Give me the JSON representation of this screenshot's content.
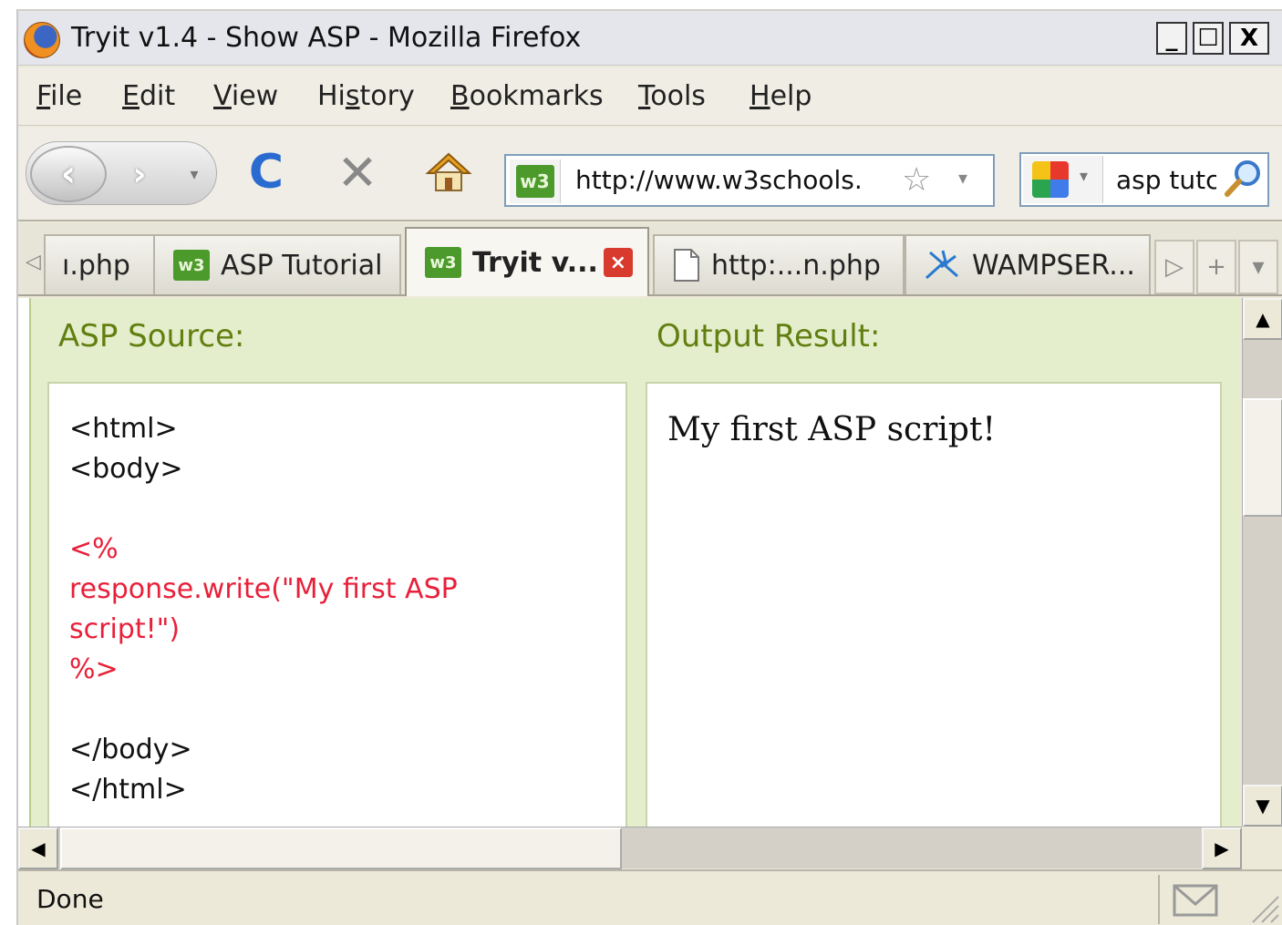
{
  "window": {
    "title": "Tryit v1.4 - Show ASP - Mozilla Firefox",
    "controls": {
      "minimize": "_",
      "maximize": "☐",
      "close": "X"
    }
  },
  "menu": [
    {
      "label": "File",
      "access": "F",
      "rest": "ile"
    },
    {
      "label": "Edit",
      "access": "E",
      "rest": "dit"
    },
    {
      "label": "View",
      "access": "V",
      "rest": "iew"
    },
    {
      "label": "History",
      "pre": "Hi",
      "access": "s",
      "rest": "tory"
    },
    {
      "label": "Bookmarks",
      "access": "B",
      "rest": "ookmarks"
    },
    {
      "label": "Tools",
      "access": "T",
      "rest": "ools"
    },
    {
      "label": "Help",
      "access": "H",
      "rest": "elp"
    }
  ],
  "navigation": {
    "back_icon": "‹",
    "forward_icon": "›",
    "history_icon": "▾",
    "reload_icon": "C",
    "stop_icon": "✕",
    "url": "http://www.w3schools.",
    "site_icon": "w3",
    "search_query": "asp tutc"
  },
  "tabs": [
    {
      "label": "ı.php",
      "icon": "none",
      "active": false
    },
    {
      "label": "ASP Tutorial",
      "icon": "w3-icon",
      "active": false
    },
    {
      "label": "Tryit v...",
      "icon": "w3-icon",
      "active": true
    },
    {
      "label": "http:...n.php",
      "icon": "page-icon",
      "active": false
    },
    {
      "label": "WAMPSER...",
      "icon": "wamp-icon",
      "active": false
    }
  ],
  "tab_controls": {
    "scroll_left": "◁",
    "scroll_right": "▷",
    "new_tab": "+",
    "list": "▾"
  },
  "tryit": {
    "source_label": "ASP Source:",
    "output_label": "Output Result:",
    "source_lines": [
      {
        "text": "<html>",
        "kind": "html"
      },
      {
        "text": "<body>",
        "kind": "html"
      },
      {
        "text": "",
        "kind": "html"
      },
      {
        "text": "<%",
        "kind": "asp"
      },
      {
        "text": "response.write(\"My first ASP",
        "kind": "asp"
      },
      {
        "text": "script!\")",
        "kind": "asp"
      },
      {
        "text": "%>",
        "kind": "asp"
      },
      {
        "text": "",
        "kind": "html"
      },
      {
        "text": "</body>",
        "kind": "html"
      },
      {
        "text": "</html>",
        "kind": "html"
      }
    ],
    "output_text": "My first ASP script!"
  },
  "scrollbars": {
    "up": "▲",
    "down": "▼",
    "left": "◀",
    "right": "▶"
  },
  "status": {
    "text": "Done"
  },
  "colors": {
    "tryit_bg": "#e5eecc",
    "section_label": "#617f10",
    "asp_code": "#e8203a",
    "w3_green": "#4d9a2c"
  }
}
